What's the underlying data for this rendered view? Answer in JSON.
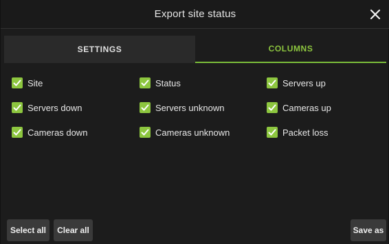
{
  "dialog": {
    "title": "Export site status",
    "close_icon": "close-icon"
  },
  "tabs": [
    {
      "label": "SETTINGS",
      "active": false
    },
    {
      "label": "COLUMNS",
      "active": true
    }
  ],
  "columns": {
    "items": [
      {
        "label": "Site",
        "checked": true
      },
      {
        "label": "Status",
        "checked": true
      },
      {
        "label": "Servers up",
        "checked": true
      },
      {
        "label": "Servers down",
        "checked": true
      },
      {
        "label": "Servers unknown",
        "checked": true
      },
      {
        "label": "Cameras up",
        "checked": true
      },
      {
        "label": "Cameras down",
        "checked": true
      },
      {
        "label": "Cameras unknown",
        "checked": true
      },
      {
        "label": "Packet loss",
        "checked": true
      }
    ]
  },
  "footer": {
    "select_all": "Select all",
    "clear_all": "Clear all",
    "save_as": "Save as"
  },
  "colors": {
    "accent": "#8dc63f",
    "background": "#1c1c1c",
    "button": "#3a3a3a"
  }
}
